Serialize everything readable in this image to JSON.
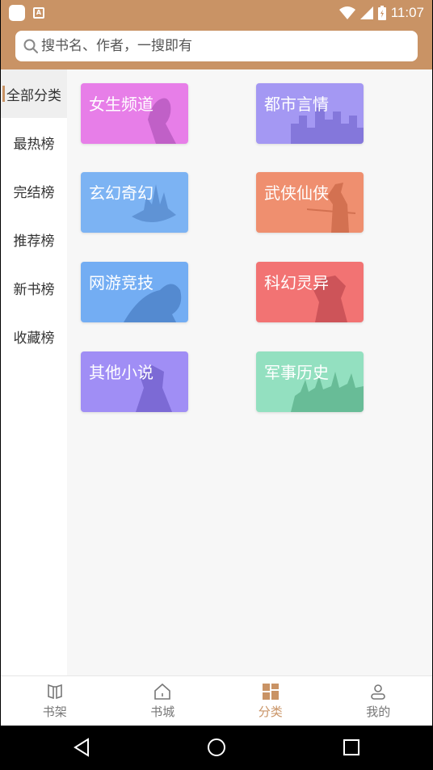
{
  "status_bar": {
    "time": "11:07",
    "notification_glyph": "A"
  },
  "search": {
    "placeholder": "搜书名、作者，一搜即有"
  },
  "sidebar": {
    "items": [
      {
        "label": "全部分类",
        "active": true
      },
      {
        "label": "最热榜",
        "active": false
      },
      {
        "label": "完结榜",
        "active": false
      },
      {
        "label": "推荐榜",
        "active": false
      },
      {
        "label": "新书榜",
        "active": false
      },
      {
        "label": "收藏榜",
        "active": false
      }
    ]
  },
  "categories": [
    {
      "label": "女生频道",
      "color": "#e77ee8"
    },
    {
      "label": "都市言情",
      "color": "#a498f3"
    },
    {
      "label": "玄幻奇幻",
      "color": "#7cb3f3"
    },
    {
      "label": "武侠仙侠",
      "color": "#ef8f6f"
    },
    {
      "label": "网游竞技",
      "color": "#73adf3"
    },
    {
      "label": "科幻灵异",
      "color": "#f27373"
    },
    {
      "label": "其他小说",
      "color": "#a08ef5"
    },
    {
      "label": "军事历史",
      "color": "#93e0c0"
    }
  ],
  "bottom_nav": {
    "items": [
      {
        "label": "书架",
        "icon": "bookshelf-icon",
        "active": false
      },
      {
        "label": "书城",
        "icon": "home-icon",
        "active": false
      },
      {
        "label": "分类",
        "icon": "category-icon",
        "active": true
      },
      {
        "label": "我的",
        "icon": "profile-icon",
        "active": false
      }
    ]
  },
  "colors": {
    "accent": "#c99365",
    "background": "#f7f7f7"
  }
}
